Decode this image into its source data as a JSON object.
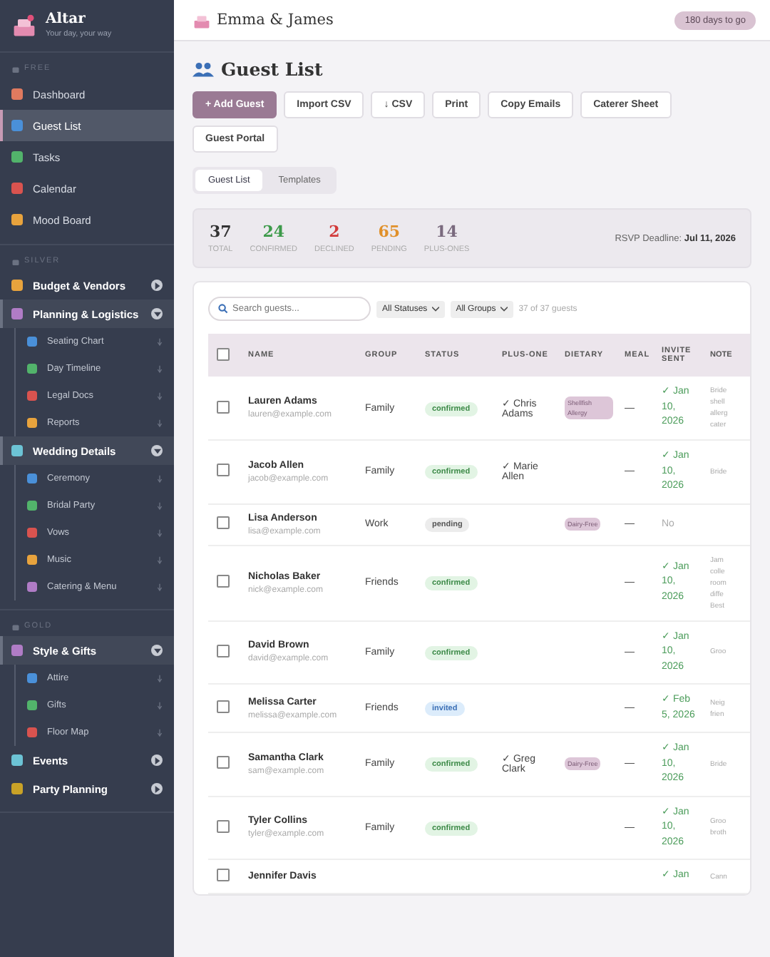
{
  "sidebar": {
    "brand": {
      "title": "Altar",
      "tagline": "Your day, your way"
    },
    "sections": [
      {
        "tier": "FREE",
        "items": [
          {
            "label": "Dashboard",
            "selected": false
          },
          {
            "label": "Guest List",
            "selected": true
          },
          {
            "label": "Tasks",
            "selected": false
          },
          {
            "label": "Calendar",
            "selected": false
          },
          {
            "label": "Mood Board",
            "selected": false
          }
        ]
      },
      {
        "tier": "SILVER",
        "groups": [
          {
            "label": "Budget & Vendors",
            "expanded": false
          },
          {
            "label": "Planning & Logistics",
            "expanded": true,
            "children": [
              "Seating Chart",
              "Day Timeline",
              "Legal Docs",
              "Reports"
            ]
          },
          {
            "label": "Wedding Details",
            "expanded": true,
            "children": [
              "Ceremony",
              "Bridal Party",
              "Vows",
              "Music",
              "Catering & Menu"
            ]
          }
        ]
      },
      {
        "tier": "GOLD",
        "groups": [
          {
            "label": "Style & Gifts",
            "expanded": true,
            "children": [
              "Attire",
              "Gifts",
              "Floor Map"
            ]
          },
          {
            "label": "Events",
            "expanded": false
          },
          {
            "label": "Party Planning",
            "expanded": false
          }
        ]
      }
    ]
  },
  "header": {
    "title": "Emma & James",
    "countdown": "180 days to go"
  },
  "page": {
    "title": "Guest List",
    "actions": [
      {
        "label": "+ Add Guest",
        "kind": "primary"
      },
      {
        "label": "Import CSV",
        "kind": "plain"
      },
      {
        "label": "↓ CSV",
        "kind": "plain"
      },
      {
        "label": "Print",
        "kind": "plain"
      },
      {
        "label": "Copy Emails",
        "kind": "plain"
      },
      {
        "label": "Caterer Sheet",
        "kind": "plain"
      },
      {
        "label": "Guest Portal",
        "kind": "plain"
      }
    ],
    "tabs": [
      {
        "label": "Guest List",
        "selected": true
      },
      {
        "label": "Templates",
        "selected": false
      }
    ],
    "stats": [
      {
        "value": "37",
        "label": "TOTAL",
        "color": "#333333"
      },
      {
        "value": "24",
        "label": "CONFIRMED",
        "color": "#3d9a4a"
      },
      {
        "value": "2",
        "label": "DECLINED",
        "color": "#d23b3b"
      },
      {
        "value": "65",
        "label": "PENDING",
        "color": "#e0902a"
      },
      {
        "value": "14",
        "label": "PLUS-ONES",
        "color": "#7a6a7e"
      }
    ],
    "deadline": {
      "label": "RSVP Deadline:",
      "date": "Jul 11, 2026"
    },
    "filters": {
      "search_placeholder": "Search guests...",
      "status": "All Statuses",
      "group": "All Groups",
      "count": "37 of 37 guests"
    },
    "table": {
      "all_checked": false,
      "columns": [
        "NAME",
        "GROUP",
        "STATUS",
        "PLUS-ONE",
        "DIETARY",
        "MEAL",
        "INVITE SENT",
        "NOTE"
      ],
      "rows": [
        {
          "name": "Lauren Adams",
          "email": "lauren@example.com",
          "group": "Family",
          "status": "confirmed",
          "plus_one": "✓ Chris Adams",
          "dietary": "Shellfish Allergy",
          "meal": "—",
          "invite": "✓ Jan 10, 2026",
          "sent": true,
          "note": [
            "Bride",
            "shell",
            "allerg",
            "cater"
          ],
          "checked": false
        },
        {
          "name": "Jacob Allen",
          "email": "jacob@example.com",
          "group": "Family",
          "status": "confirmed",
          "plus_one": "✓ Marie Allen",
          "meal": "—",
          "invite": "✓ Jan 10, 2026",
          "sent": true,
          "note": [
            "Bride"
          ],
          "checked": false
        },
        {
          "name": "Lisa Anderson",
          "email": "lisa@example.com",
          "group": "Work",
          "status": "pending",
          "dietary": "Dairy-Free",
          "meal": "—",
          "invite": "No",
          "sent": false,
          "checked": false
        },
        {
          "name": "Nicholas Baker",
          "email": "nick@example.com",
          "group": "Friends",
          "status": "confirmed",
          "meal": "—",
          "invite": "✓ Jan 10, 2026",
          "sent": true,
          "note": [
            "Jam",
            "colle",
            "room",
            "diffe",
            "Best"
          ],
          "checked": false
        },
        {
          "name": "David Brown",
          "email": "david@example.com",
          "group": "Family",
          "status": "confirmed",
          "meal": "—",
          "invite": "✓ Jan 10, 2026",
          "sent": true,
          "note": [
            "Groo"
          ],
          "checked": false
        },
        {
          "name": "Melissa Carter",
          "email": "melissa@example.com",
          "group": "Friends",
          "status": "invited",
          "meal": "—",
          "invite": "✓ Feb 5, 2026",
          "sent": true,
          "note": [
            "Neig",
            "frien"
          ],
          "checked": false
        },
        {
          "name": "Samantha Clark",
          "email": "sam@example.com",
          "group": "Family",
          "status": "confirmed",
          "plus_one": "✓ Greg Clark",
          "dietary": "Dairy-Free",
          "meal": "—",
          "invite": "✓ Jan 10, 2026",
          "sent": true,
          "note": [
            "Bride"
          ],
          "checked": false
        },
        {
          "name": "Tyler Collins",
          "email": "tyler@example.com",
          "group": "Family",
          "status": "confirmed",
          "meal": "—",
          "invite": "✓ Jan 10, 2026",
          "sent": true,
          "note": [
            "Groo",
            "broth"
          ],
          "checked": false
        },
        {
          "name": "Jennifer Davis",
          "invite": "✓ Jan",
          "sent": true,
          "note": [
            "Cann"
          ],
          "checked": false
        }
      ]
    }
  }
}
